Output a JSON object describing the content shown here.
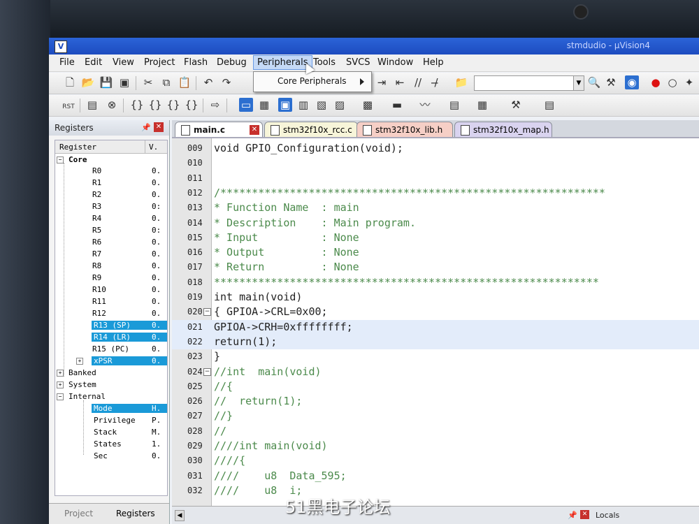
{
  "window": {
    "title": "stmdudio - µVision4"
  },
  "menu": {
    "items": [
      "File",
      "Edit",
      "View",
      "Project",
      "Flash",
      "Debug",
      "Peripherals",
      "Tools",
      "SVCS",
      "Window",
      "Help"
    ],
    "active": "Peripherals"
  },
  "dropdown": {
    "item": "Core Peripherals"
  },
  "toolbar2": {
    "rst_label": "RST"
  },
  "registers_panel": {
    "title": "Registers",
    "col_register": "Register",
    "col_value": "V.",
    "groups": {
      "core": "Core",
      "banked": "Banked",
      "system": "System",
      "internal": "Internal"
    },
    "core_rows": [
      {
        "name": "R0",
        "value": "0."
      },
      {
        "name": "R1",
        "value": "0."
      },
      {
        "name": "R2",
        "value": "0."
      },
      {
        "name": "R3",
        "value": "0:"
      },
      {
        "name": "R4",
        "value": "0."
      },
      {
        "name": "R5",
        "value": "0:"
      },
      {
        "name": "R6",
        "value": "0."
      },
      {
        "name": "R7",
        "value": "0."
      },
      {
        "name": "R8",
        "value": "0."
      },
      {
        "name": "R9",
        "value": "0."
      },
      {
        "name": "R10",
        "value": "0."
      },
      {
        "name": "R11",
        "value": "0."
      },
      {
        "name": "R12",
        "value": "0."
      },
      {
        "name": "R13 (SP)",
        "value": "0."
      },
      {
        "name": "R14 (LR)",
        "value": "0."
      },
      {
        "name": "R15 (PC)",
        "value": "0."
      },
      {
        "name": "xPSR",
        "value": "0."
      }
    ],
    "internal_rows": [
      {
        "name": "Mode",
        "value": "H."
      },
      {
        "name": "Privilege",
        "value": "P."
      },
      {
        "name": "Stack",
        "value": "M."
      },
      {
        "name": "States",
        "value": "1."
      },
      {
        "name": "Sec",
        "value": "0."
      }
    ],
    "bottom_tabs": [
      "Project",
      "Registers"
    ]
  },
  "tabs": [
    "main.c",
    "stm32f10x_rcc.c",
    "stm32f10x_lib.h",
    "stm32f10x_map.h"
  ],
  "editor": {
    "lines": [
      {
        "n": "009",
        "t": "void GPIO_Configuration(void);"
      },
      {
        "n": "010",
        "t": ""
      },
      {
        "n": "011",
        "t": ""
      },
      {
        "n": "012",
        "t": "/*************************************************************"
      },
      {
        "n": "013",
        "t": "* Function Name  : main"
      },
      {
        "n": "014",
        "t": "* Description    : Main program."
      },
      {
        "n": "015",
        "t": "* Input          : None"
      },
      {
        "n": "016",
        "t": "* Output         : None"
      },
      {
        "n": "017",
        "t": "* Return         : None"
      },
      {
        "n": "018",
        "t": "*************************************************************"
      },
      {
        "n": "019",
        "t": "int main(void)"
      },
      {
        "n": "020",
        "t": "{ GPIOA->CRL=0x00;"
      },
      {
        "n": "021",
        "t": "GPIOA->CRH=0xffffffff;"
      },
      {
        "n": "022",
        "t": "return(1);"
      },
      {
        "n": "023",
        "t": "}"
      },
      {
        "n": "024",
        "t": "//int  main(void)"
      },
      {
        "n": "025",
        "t": "//{"
      },
      {
        "n": "026",
        "t": "//  return(1);"
      },
      {
        "n": "027",
        "t": "//}"
      },
      {
        "n": "028",
        "t": "//"
      },
      {
        "n": "029",
        "t": "////int main(void)"
      },
      {
        "n": "030",
        "t": "////{"
      },
      {
        "n": "031",
        "t": "////    u8  Data_595;"
      },
      {
        "n": "032",
        "t": "////    u8  i;"
      }
    ]
  },
  "status": {
    "locals": "Locals"
  },
  "watermark": "51黑电子论坛"
}
